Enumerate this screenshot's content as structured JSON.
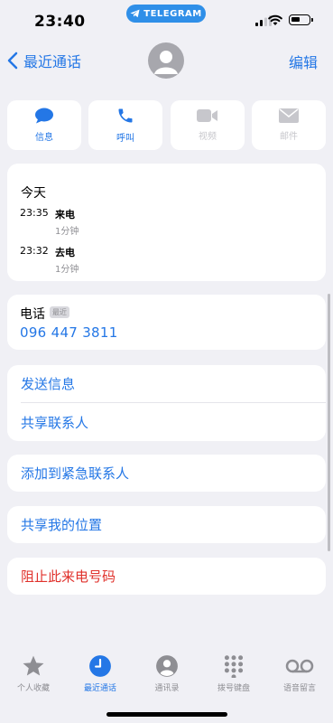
{
  "status_bar": {
    "time": "23:40",
    "telegram": "TELEGRAM"
  },
  "nav": {
    "back_label": "最近通话",
    "edit_label": "编辑"
  },
  "actions": [
    {
      "label": "信息",
      "icon": "message-icon",
      "enabled": true
    },
    {
      "label": "呼叫",
      "icon": "phone-icon",
      "enabled": true
    },
    {
      "label": "视频",
      "icon": "video-icon",
      "enabled": false
    },
    {
      "label": "邮件",
      "icon": "mail-icon",
      "enabled": false
    }
  ],
  "recents": {
    "heading": "今天",
    "calls": [
      {
        "time": "23:35",
        "type": "来电",
        "duration": "1分钟"
      },
      {
        "time": "23:32",
        "type": "去电",
        "duration": "1分钟"
      }
    ]
  },
  "phone": {
    "label": "电话",
    "tag": "最近",
    "number": "096 447 3811"
  },
  "options": {
    "send_message": "发送信息",
    "share_contact": "共享联系人",
    "add_emergency": "添加到紧急联系人",
    "share_location": "共享我的位置",
    "block_caller": "阻止此来电号码"
  },
  "tabbar": [
    {
      "label": "个人收藏",
      "icon": "star-icon",
      "active": false
    },
    {
      "label": "最近通话",
      "icon": "clock-icon",
      "active": true
    },
    {
      "label": "通讯录",
      "icon": "contact-icon",
      "active": false
    },
    {
      "label": "拨号键盘",
      "icon": "keypad-icon",
      "active": false
    },
    {
      "label": "语音留言",
      "icon": "voicemail-icon",
      "active": false
    }
  ],
  "colors": {
    "accent": "#2477e6",
    "destructive": "#e0312b",
    "background": "#f0f0f5",
    "telegram": "#2f8fe8"
  }
}
